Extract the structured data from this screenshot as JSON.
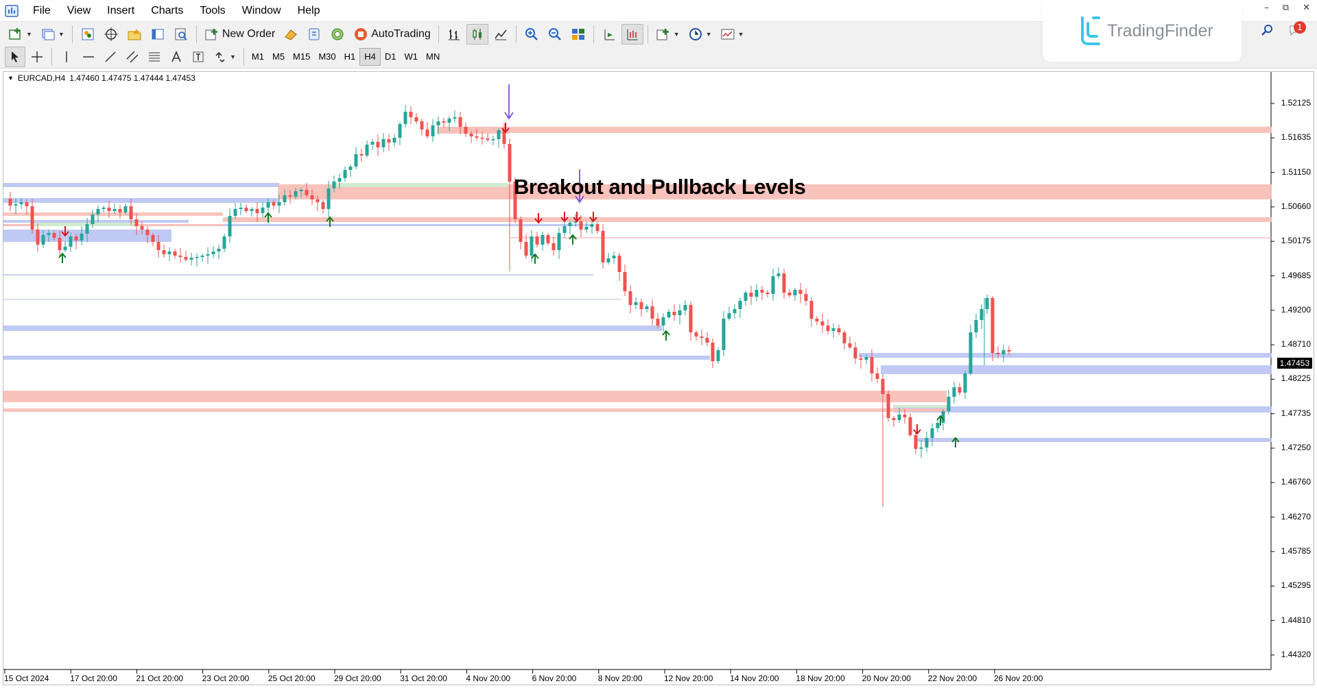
{
  "menu": [
    "File",
    "View",
    "Insert",
    "Charts",
    "Tools",
    "Window",
    "Help"
  ],
  "toolbar": {
    "new_order_label": "New Order",
    "autotrading_label": "AutoTrading",
    "timeframes": [
      "M1",
      "M5",
      "M15",
      "M30",
      "H1",
      "H4",
      "D1",
      "W1",
      "MN"
    ],
    "active_timeframe": "H4"
  },
  "brand": {
    "name": "TradingFinder",
    "notification_count": "1"
  },
  "chart": {
    "symbol_text": "EURCAD,H4",
    "ohlc_text": "1.47460 1.47475 1.47444 1.47453",
    "annotation": "Breakout and Pullback Levels",
    "current_price": "1.47453",
    "price_labels": [
      "1.52125",
      "1.51635",
      "1.51150",
      "1.50660",
      "1.50175",
      "1.49685",
      "1.49200",
      "1.48710",
      "1.48225",
      "1.47735",
      "1.47250",
      "1.46760",
      "1.46270",
      "1.45785",
      "1.45295",
      "1.44810",
      "1.44320"
    ],
    "date_labels": [
      "15 Oct 2024",
      "17 Oct 20:00",
      "21 Oct 20:00",
      "23 Oct 20:00",
      "25 Oct 20:00",
      "29 Oct 20:00",
      "31 Oct 20:00",
      "4 Nov 20:00",
      "6 Nov 20:00",
      "8 Nov 20:00",
      "12 Nov 20:00",
      "14 Nov 20:00",
      "18 Nov 20:00",
      "20 Nov 20:00",
      "22 Nov 20:00",
      "26 Nov 20:00"
    ],
    "colors": {
      "bull": "#26a69a",
      "bear": "#ef5350",
      "supply_zone": "#f9c0b8",
      "demand_zone": "#bcc6f2",
      "pullback_zone": "#cdeccd",
      "arrow_buy": "#0f7a20",
      "arrow_sell": "#d8141e",
      "pointer": "#7b4fe0"
    }
  }
}
